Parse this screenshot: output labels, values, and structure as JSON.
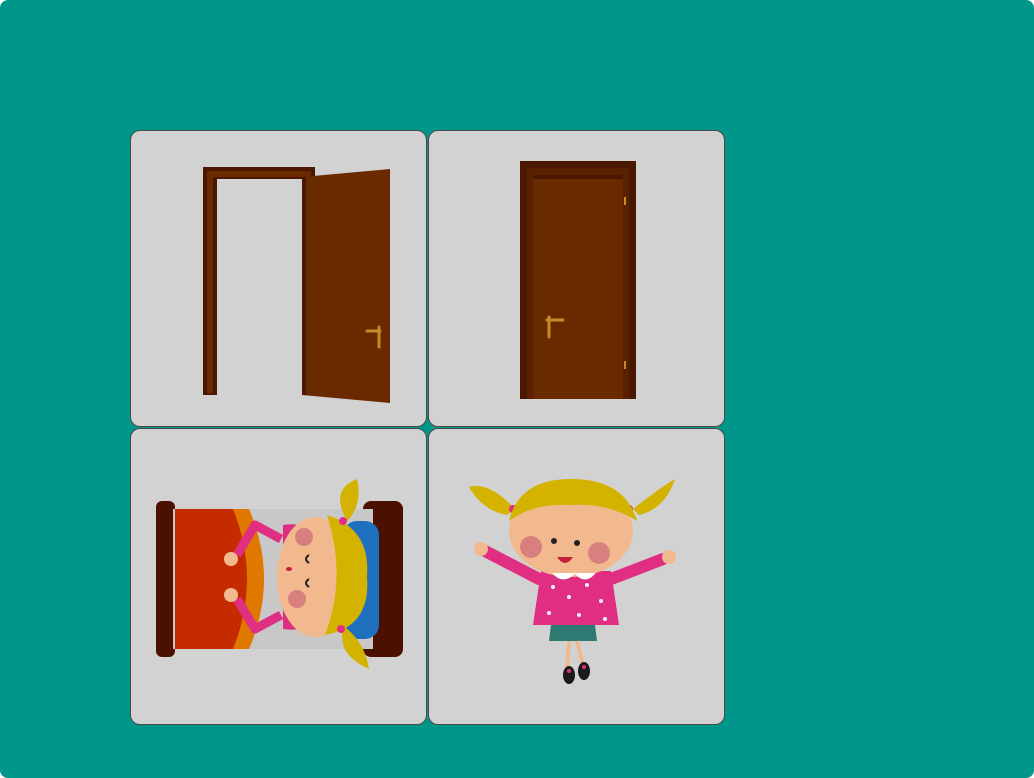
{
  "cards": [
    {
      "id": "open-door",
      "icon": "open-door-icon"
    },
    {
      "id": "closed-door",
      "icon": "closed-door-icon"
    },
    {
      "id": "girl-in-bed",
      "icon": "girl-sleeping-in-bed-icon"
    },
    {
      "id": "happy-girl",
      "icon": "girl-waking-up-icon"
    }
  ],
  "colors": {
    "background": "#00968a",
    "card": "#d2d2d2",
    "door": "#6a2a00",
    "door_frame": "#4a1800",
    "hair": "#d4b300",
    "dress": "#e02e82"
  }
}
